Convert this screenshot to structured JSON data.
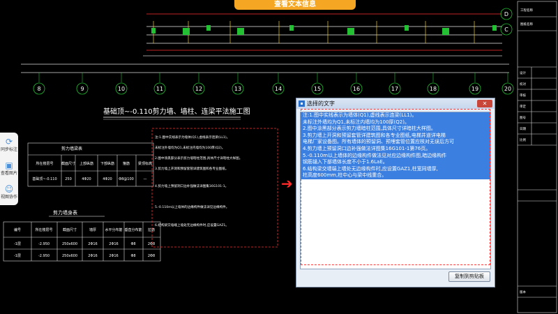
{
  "banner": {
    "text": "查看文本信息"
  },
  "cad": {
    "circle_labels": [
      "8",
      "9",
      "10",
      "11",
      "12",
      "13",
      "14",
      "15",
      "16",
      "17",
      "18",
      "19",
      "20"
    ],
    "right_labels": [
      "D",
      "C"
    ],
    "drawing_title": "基础顶~-0.110剪力墙、墙柱、连梁平法施工图",
    "table1_title": "剪力墙梁表",
    "table1_headers": [
      "编号",
      "所在楼层号",
      "截面尺寸",
      "上部纵筋",
      "下部纵筋",
      "箍筋",
      "梁顶标高"
    ],
    "table1_row": [
      "LL1",
      "基础顶~-0.110",
      "250",
      "4Φ20",
      "4Φ20",
      "Φ8@100",
      "—"
    ],
    "table2_title": "剪力墙身表",
    "table2_headers": [
      "编号",
      "所在楼层号",
      "截面尺寸",
      "墙厚",
      "水平分布筋",
      "垂直分布筋",
      "拉筋"
    ],
    "table2_rows": [
      [
        "-1层",
        "-2.950",
        "250x600",
        "2Φ16",
        "2Φ16",
        "Φ8",
        "2Φ8"
      ],
      [
        "-1层",
        "-2.950",
        "250x600",
        "2Φ16",
        "2Φ16",
        "Φ8",
        "2Φ8"
      ]
    ],
    "notes": [
      "注:1.图中实线表示为墙体(Q1),虚线表示连梁(LL1)。",
      "未标注外墙均为Q1,未标注内墙均为100厚(Q2)。",
      "2.图中涂黑部分表示剪力墙暗柱范围,具体尺寸详暗柱大样图。",
      "3.剪力墙上开洞和预留套管详建筑图和各专业图纸。",
      "4.剪力墙上预留洞口边补强做法详图集16G101-1。",
      "5.-0.110m以上墙体的边缘构件做法详见边缘构件。",
      "6.结构梁交墙端上墙处无边缘构件时,应设置GAZ1。"
    ],
    "title_block": [
      "工程名称",
      "图纸名称",
      "设计",
      "校对",
      "审核",
      "审定",
      "图号",
      "日期",
      "比例",
      "版本"
    ]
  },
  "toolbar": {
    "items": [
      {
        "label": "同步标注",
        "icon": "refresh-icon"
      },
      {
        "label": "查看图片",
        "icon": "image-icon"
      },
      {
        "label": "视图协作",
        "icon": "people-icon"
      }
    ]
  },
  "dialog": {
    "title": "选择的文字",
    "close": "✕",
    "lines": [
      "注:1.图中实线表示为墙体(Q1),虚线表示连梁(LL1)。",
      "未标注外墙均为Q1,未标注内墙均为100厚(Q2)。",
      "2.图中涂黑部分表示剪力墙暗柱范围,具体尺寸详暗柱大样图。",
      "3.剪力墙上开洞和预留套管详建筑图和各专业图纸,电梯井道详电梯",
      "电梯厂家设备图。所有墙体的预留洞、预埋套管位置应核对无误后方可",
      "4.剪力墙上预留洞口边补强做法详图集16G101-1第76页。",
      "5.-0.110m以上墙体的边缘构件做法见对应边缘构件图,暗边缘构件",
      "钢筋锚入下部墙体长度不小于1.6LaE。",
      "6.结构梁交墙端上墙处无边缘构件时,应设置GAZ1,柱宽同墙厚,",
      "柱高度600mm,柱中心与梁中线重合。"
    ],
    "selected_count": 10,
    "copy_button": "复制到剪贴板"
  },
  "colors": {
    "banner": "#f5a623",
    "selection": "#3b7fe0",
    "cad_green": "#22c032",
    "cad_red": "#ff3030",
    "cad_yellow": "#f0d020"
  }
}
